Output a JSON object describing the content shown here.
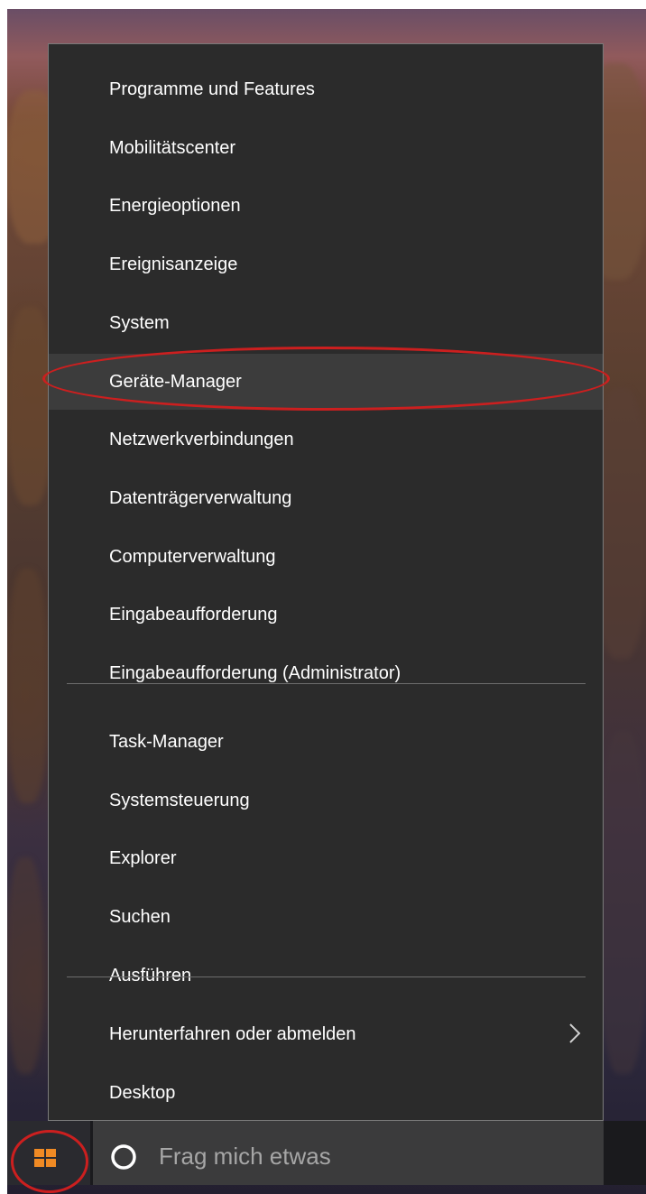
{
  "context_menu": {
    "group1": [
      {
        "label": "Programme und Features"
      },
      {
        "label": "Mobilitätscenter"
      },
      {
        "label": "Energieoptionen"
      },
      {
        "label": "Ereignisanzeige"
      },
      {
        "label": "System"
      },
      {
        "label": "Geräte-Manager",
        "highlighted": true
      },
      {
        "label": "Netzwerkverbindungen"
      },
      {
        "label": "Datenträgerverwaltung"
      },
      {
        "label": "Computerverwaltung"
      },
      {
        "label": "Eingabeaufforderung"
      },
      {
        "label": "Eingabeaufforderung (Administrator)"
      }
    ],
    "group2": [
      {
        "label": "Task-Manager"
      },
      {
        "label": "Systemsteuerung"
      },
      {
        "label": "Explorer"
      },
      {
        "label": "Suchen"
      },
      {
        "label": "Ausführen"
      }
    ],
    "group3": [
      {
        "label": "Herunterfahren oder abmelden",
        "has_submenu": true,
        "submenu_icon": "chevron-right-icon"
      },
      {
        "label": "Desktop"
      }
    ]
  },
  "taskbar": {
    "start_icon": "windows-logo-icon",
    "search_icon": "cortana-circle-icon",
    "search_placeholder": "Frag mich etwas"
  },
  "annotations": {
    "color": "#cc1f1f",
    "circled": [
      "Geräte-Manager",
      "windows-logo-icon"
    ]
  },
  "colors": {
    "menu_background": "#2b2b2b",
    "menu_highlight": "#3c3c3c",
    "menu_text": "#ffffff",
    "separator": "#6d6d6d",
    "search_box": "#3b3b3c",
    "search_text": "#a6a6a6"
  }
}
